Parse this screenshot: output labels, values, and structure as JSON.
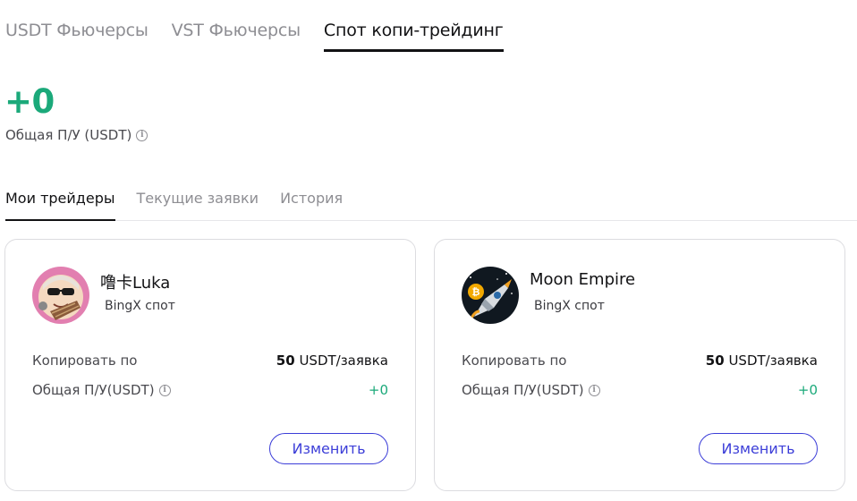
{
  "top_tabs": [
    "USDT Фьючерсы",
    "VST Фьючерсы",
    "Спот копи-трейдинг"
  ],
  "summary": {
    "pnl_value": "+0",
    "pnl_label": "Общая П/У (USDT)"
  },
  "sub_tabs": [
    "Мои трейдеры",
    "Текущие заявки",
    "История"
  ],
  "traders": [
    {
      "name": "噜卡Luka",
      "platform": "BingX спот",
      "copy_label": "Копировать по",
      "copy_amount": "50",
      "copy_unit": " USDT/заявка",
      "pnl_label": "Общая П/У(USDT)",
      "pnl_value": "+0",
      "edit_label": "Изменить"
    },
    {
      "name": "Moon Empire",
      "platform": "BingX спот",
      "copy_label": "Копировать по",
      "copy_amount": "50",
      "copy_unit": " USDT/заявка",
      "pnl_label": "Общая П/У(USDT)",
      "pnl_value": "+0",
      "edit_label": "Изменить"
    }
  ],
  "colors": {
    "accent": "#3c3ed8",
    "positive": "#1ba97a",
    "avatar1_bg": "#e27fb0",
    "avatar2_bg": "#101820"
  },
  "icons": [
    "info-icon",
    "avatar-cartoon",
    "avatar-bitcoin-rocket"
  ]
}
